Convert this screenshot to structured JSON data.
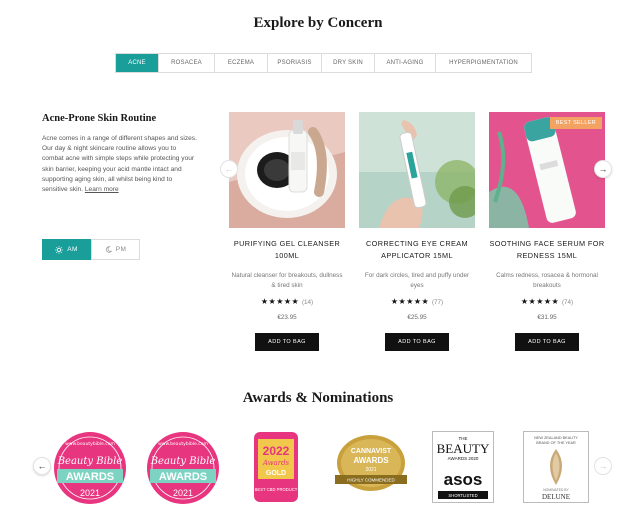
{
  "headings": {
    "explore": "Explore by Concern",
    "awards": "Awards & Nominations"
  },
  "tabs": [
    {
      "label": "ACNE",
      "active": true
    },
    {
      "label": "ROSACEA",
      "active": false
    },
    {
      "label": "ECZEMA",
      "active": false
    },
    {
      "label": "PSORIASIS",
      "active": false
    },
    {
      "label": "DRY SKIN",
      "active": false
    },
    {
      "label": "ANTI-AGING",
      "active": false
    },
    {
      "label": "HYPERPIGMENTATION",
      "active": false
    }
  ],
  "routine": {
    "title": "Acne-Prone Skin Routine",
    "description": "Acne comes in a range of different shapes and sizes. Our day & night skincare routine allows you to combat acne with simple steps while protecting your skin barrier, keeping your acid mantle intact and supporting aging skin, all whilst being kind to sensitive skin.",
    "learn_more": "Learn more",
    "am_label": "AM",
    "pm_label": "PM",
    "am_icon": "sun-icon",
    "pm_icon": "moon-icon"
  },
  "products": [
    {
      "name": "PURIFYING GEL CLEANSER 100ML",
      "description": "Natural cleanser for breakouts, dullness & tired skin",
      "stars": "★★★★★",
      "rating": 5,
      "reviews": "(14)",
      "price": "€23.95",
      "button": "ADD TO BAG"
    },
    {
      "name": "CORRECTING EYE CREAM APPLICATOR 15ML",
      "description": "For dark circles, tired and puffy under eyes",
      "stars": "★★★★★",
      "rating": 5,
      "reviews": "(77)",
      "price": "€25.95",
      "button": "ADD TO BAG"
    },
    {
      "name": "SOOTHING FACE SERUM FOR REDNESS 15ML",
      "description": "Calms redness, rosacea & hormonal breakouts",
      "stars": "★★★★★",
      "rating": 5,
      "reviews": "(74)",
      "price": "€31.95",
      "button": "ADD TO BAG",
      "badge": "BEST SELLER"
    }
  ],
  "awards": {
    "beauty_bible_1": {
      "site": "www.beautybible.com",
      "script": "Beauty Bible",
      "word": "AWARDS",
      "year": "2021"
    },
    "beauty_bible_2": {
      "site": "www.beautybible.com",
      "script": "Beauty Bible",
      "word": "AWARDS",
      "year": "2021"
    },
    "badge_2022": {
      "year": "2022",
      "script": "Awards",
      "tier": "GOLD",
      "category": "BEST CBD PRODUCT"
    },
    "cannavist": {
      "name": "CANNAVIST",
      "word": "AWARDS",
      "year": "2021",
      "ribbon": "HIGHLY COMMENDED"
    },
    "asos": {
      "top": "THE",
      "mid": "BEAUTY",
      "sub": "AWARDS 2020",
      "brand": "asos",
      "foot": "SHORTLISTED"
    },
    "delune": {
      "line1": "NEW ZEALAND BEAUTY",
      "line2": "BRAND OF THE YEAR",
      "small": "NOMINATED BY",
      "brand": "DELUNE"
    }
  },
  "arrows": {
    "prev": "←",
    "next": "→"
  },
  "colors": {
    "accent": "#1a9e9a",
    "badge": "#f4a261",
    "button": "#111111",
    "award_pink": "#e8357f",
    "award_gold": "#c9a13c"
  }
}
